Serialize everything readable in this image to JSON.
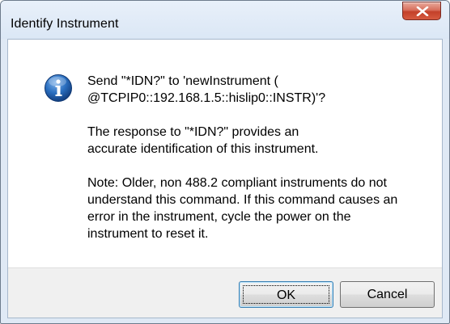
{
  "window": {
    "title": "Identify Instrument",
    "close_icon": "close-icon"
  },
  "dialog": {
    "icon": "info-icon",
    "message_line1": "Send \"*IDN?\" to 'newInstrument (\n@TCPIP0::192.168.1.5::hislip0::INSTR)'?",
    "message_line2": "The response to \"*IDN?\" provides an\naccurate identification of this instrument.",
    "message_line3": "Note: Older, non 488.2 compliant instruments do not\nunderstand this command. If this command causes an\nerror in the instrument, cycle the power on the\ninstrument to reset it."
  },
  "buttons": {
    "ok_label": "OK",
    "cancel_label": "Cancel"
  },
  "colors": {
    "titlebar": "#dbe7f5",
    "close_button": "#c3402a",
    "info_icon": "#1c5aa6",
    "button_bar": "#f0f0f0"
  }
}
